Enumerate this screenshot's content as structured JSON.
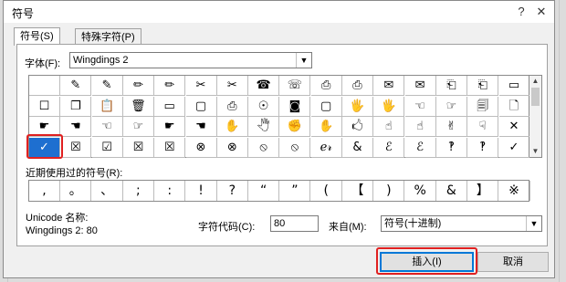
{
  "window": {
    "title": "符号",
    "help_icon": "?",
    "close_icon": "✕"
  },
  "tabs": [
    {
      "label": "符号(S)",
      "active": true
    },
    {
      "label": "特殊字符(P)",
      "active": false
    }
  ],
  "font": {
    "label": "字体(F):",
    "value": "Wingdings 2"
  },
  "symbol_rows": [
    [
      "",
      "✎",
      "✎",
      "✏",
      "✏",
      "✂",
      "✂",
      "☎",
      "☏",
      "⎙",
      "⎙",
      "✉",
      "✉",
      "⎗",
      "⎗",
      "▭"
    ],
    [
      "☐",
      "❐",
      "📋",
      "🗑",
      "▭",
      "▢",
      "⎙",
      "☉",
      "◙",
      "▢",
      "🖐",
      "🖐",
      "☜",
      "☞",
      "🗐",
      "🗋"
    ],
    [
      "☛",
      "☚",
      "☜",
      "☞",
      "☛",
      "☚",
      "✋",
      "🖑",
      "✊",
      "✋",
      "🖒",
      "☝",
      "☝",
      "✌",
      "☟",
      "✕"
    ],
    [
      "✓",
      "☒",
      "☑",
      "☒",
      "☒",
      "⊗",
      "⊗",
      "⦸",
      "⦸",
      "ℯ𝓇",
      "&",
      "ℰ",
      "ℰ",
      "‽",
      "‽",
      "✓"
    ]
  ],
  "selected_symbol": "✓",
  "recent": {
    "label": "近期使用过的符号(R):",
    "items": [
      ",",
      "。",
      "、",
      ";",
      ":",
      "!",
      "?",
      "“",
      "”",
      "(",
      "【",
      ")",
      "%",
      "&",
      "】",
      "※"
    ]
  },
  "unicode": {
    "name_label": "Unicode 名称:",
    "name_value": "Wingdings 2: 80"
  },
  "char_code": {
    "label": "字符代码(C):",
    "value": "80"
  },
  "from": {
    "label": "来自(M):",
    "value": "符号(十进制)"
  },
  "buttons": {
    "insert": "插入(I)",
    "cancel": "取消"
  },
  "colors": {
    "selection": "#1e6fd0",
    "highlight": "#e02020"
  }
}
